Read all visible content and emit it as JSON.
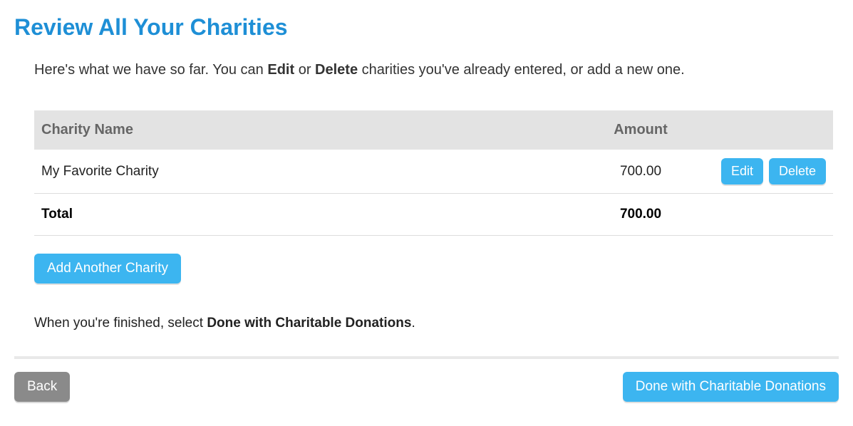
{
  "title": "Review All Your Charities",
  "intro": {
    "part1": "Here's what we have so far. You can ",
    "bold1": "Edit",
    "part2": " or ",
    "bold2": "Delete",
    "part3": " charities you've already entered, or add a new one."
  },
  "table": {
    "headers": {
      "charity_name": "Charity Name",
      "amount": "Amount"
    },
    "rows": [
      {
        "name": "My Favorite Charity",
        "amount": "700.00"
      }
    ],
    "total": {
      "label": "Total",
      "amount": "700.00"
    }
  },
  "buttons": {
    "edit": "Edit",
    "delete": "Delete",
    "add_another": "Add Another Charity",
    "back": "Back",
    "done": "Done with Charitable Donations"
  },
  "finish": {
    "part1": "When you're finished, select ",
    "bold": "Done with Charitable Donations",
    "part2": "."
  }
}
